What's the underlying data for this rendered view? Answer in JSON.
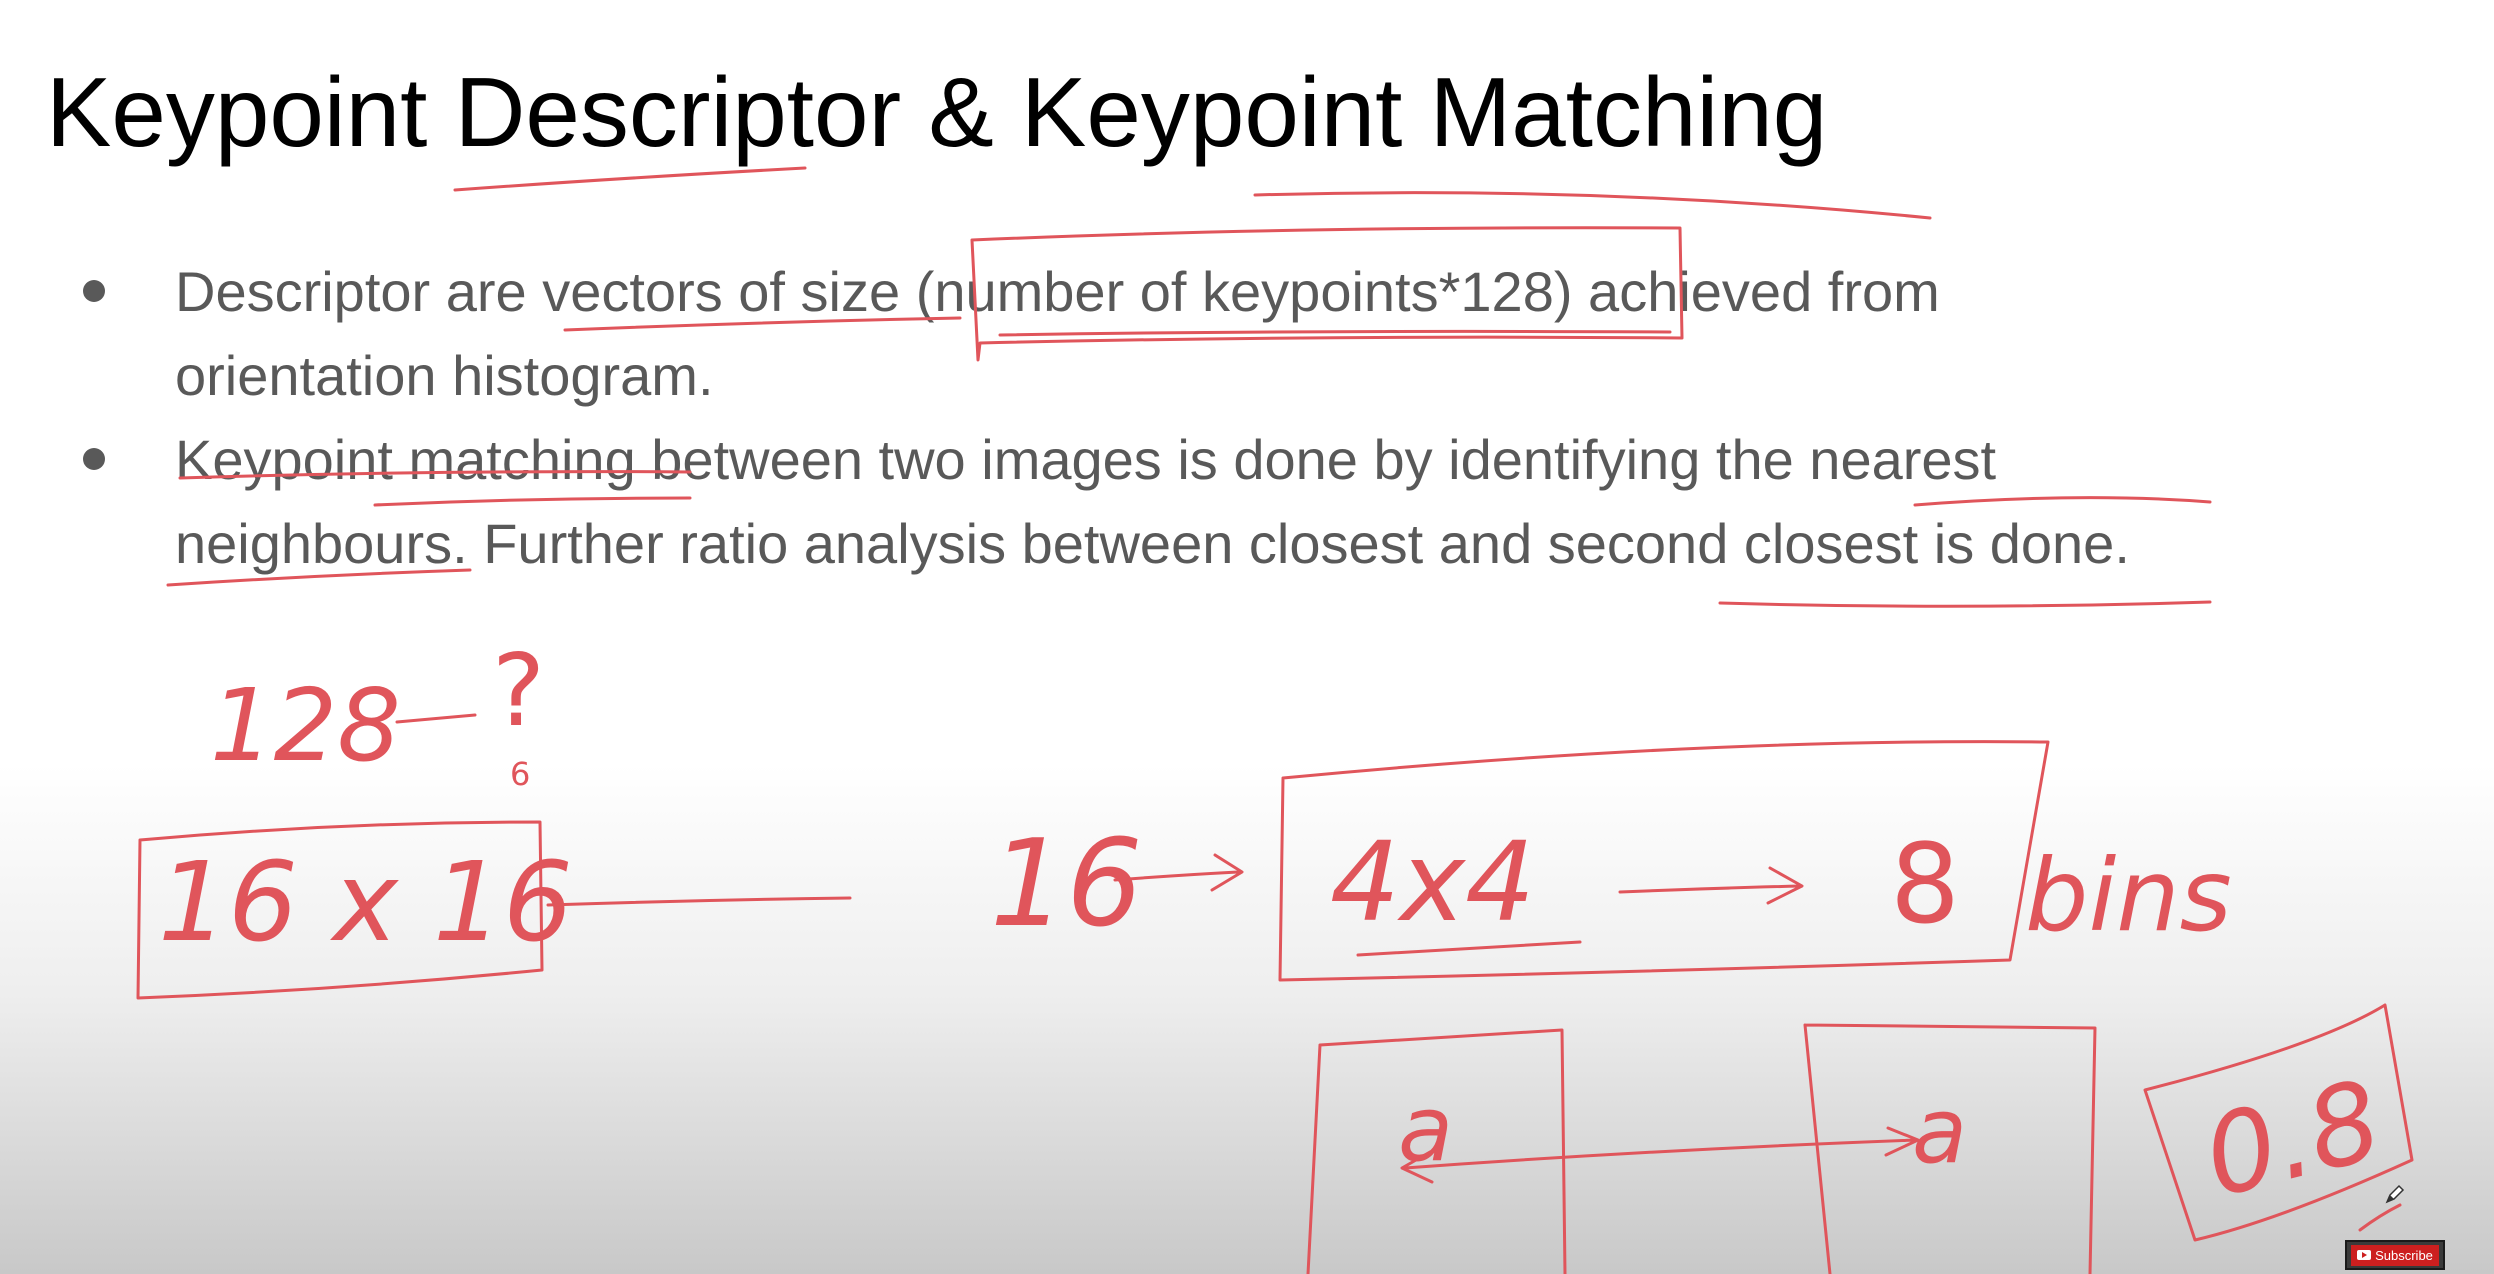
{
  "slide": {
    "title": "Keypoint Descriptor & Keypoint Matching",
    "bullets": [
      {
        "line1": "Descriptor are vectors of size (number of keypoints*128) achieved from",
        "line2": "orientation histogram."
      },
      {
        "line1": "Keypoint matching between two images is done by identifying the nearest",
        "line2": "neighbours. Further ratio analysis between closest and second closest is done."
      }
    ]
  },
  "annotations": {
    "top_number": "128",
    "question_mark": "?",
    "small_digit": "6",
    "box_left": "16 x 16",
    "middle_number": "16",
    "box_right_left": "4x4",
    "box_right_right": "8",
    "bins_word": "bins",
    "match_letter_left": "a",
    "match_letter_right": "a",
    "ratio_value": "0.8",
    "ink_color": "#e0555b"
  },
  "overlay": {
    "subscribe_label": "Subscribe",
    "icons": [
      "youtube-icon",
      "pencil-cursor-icon"
    ]
  }
}
